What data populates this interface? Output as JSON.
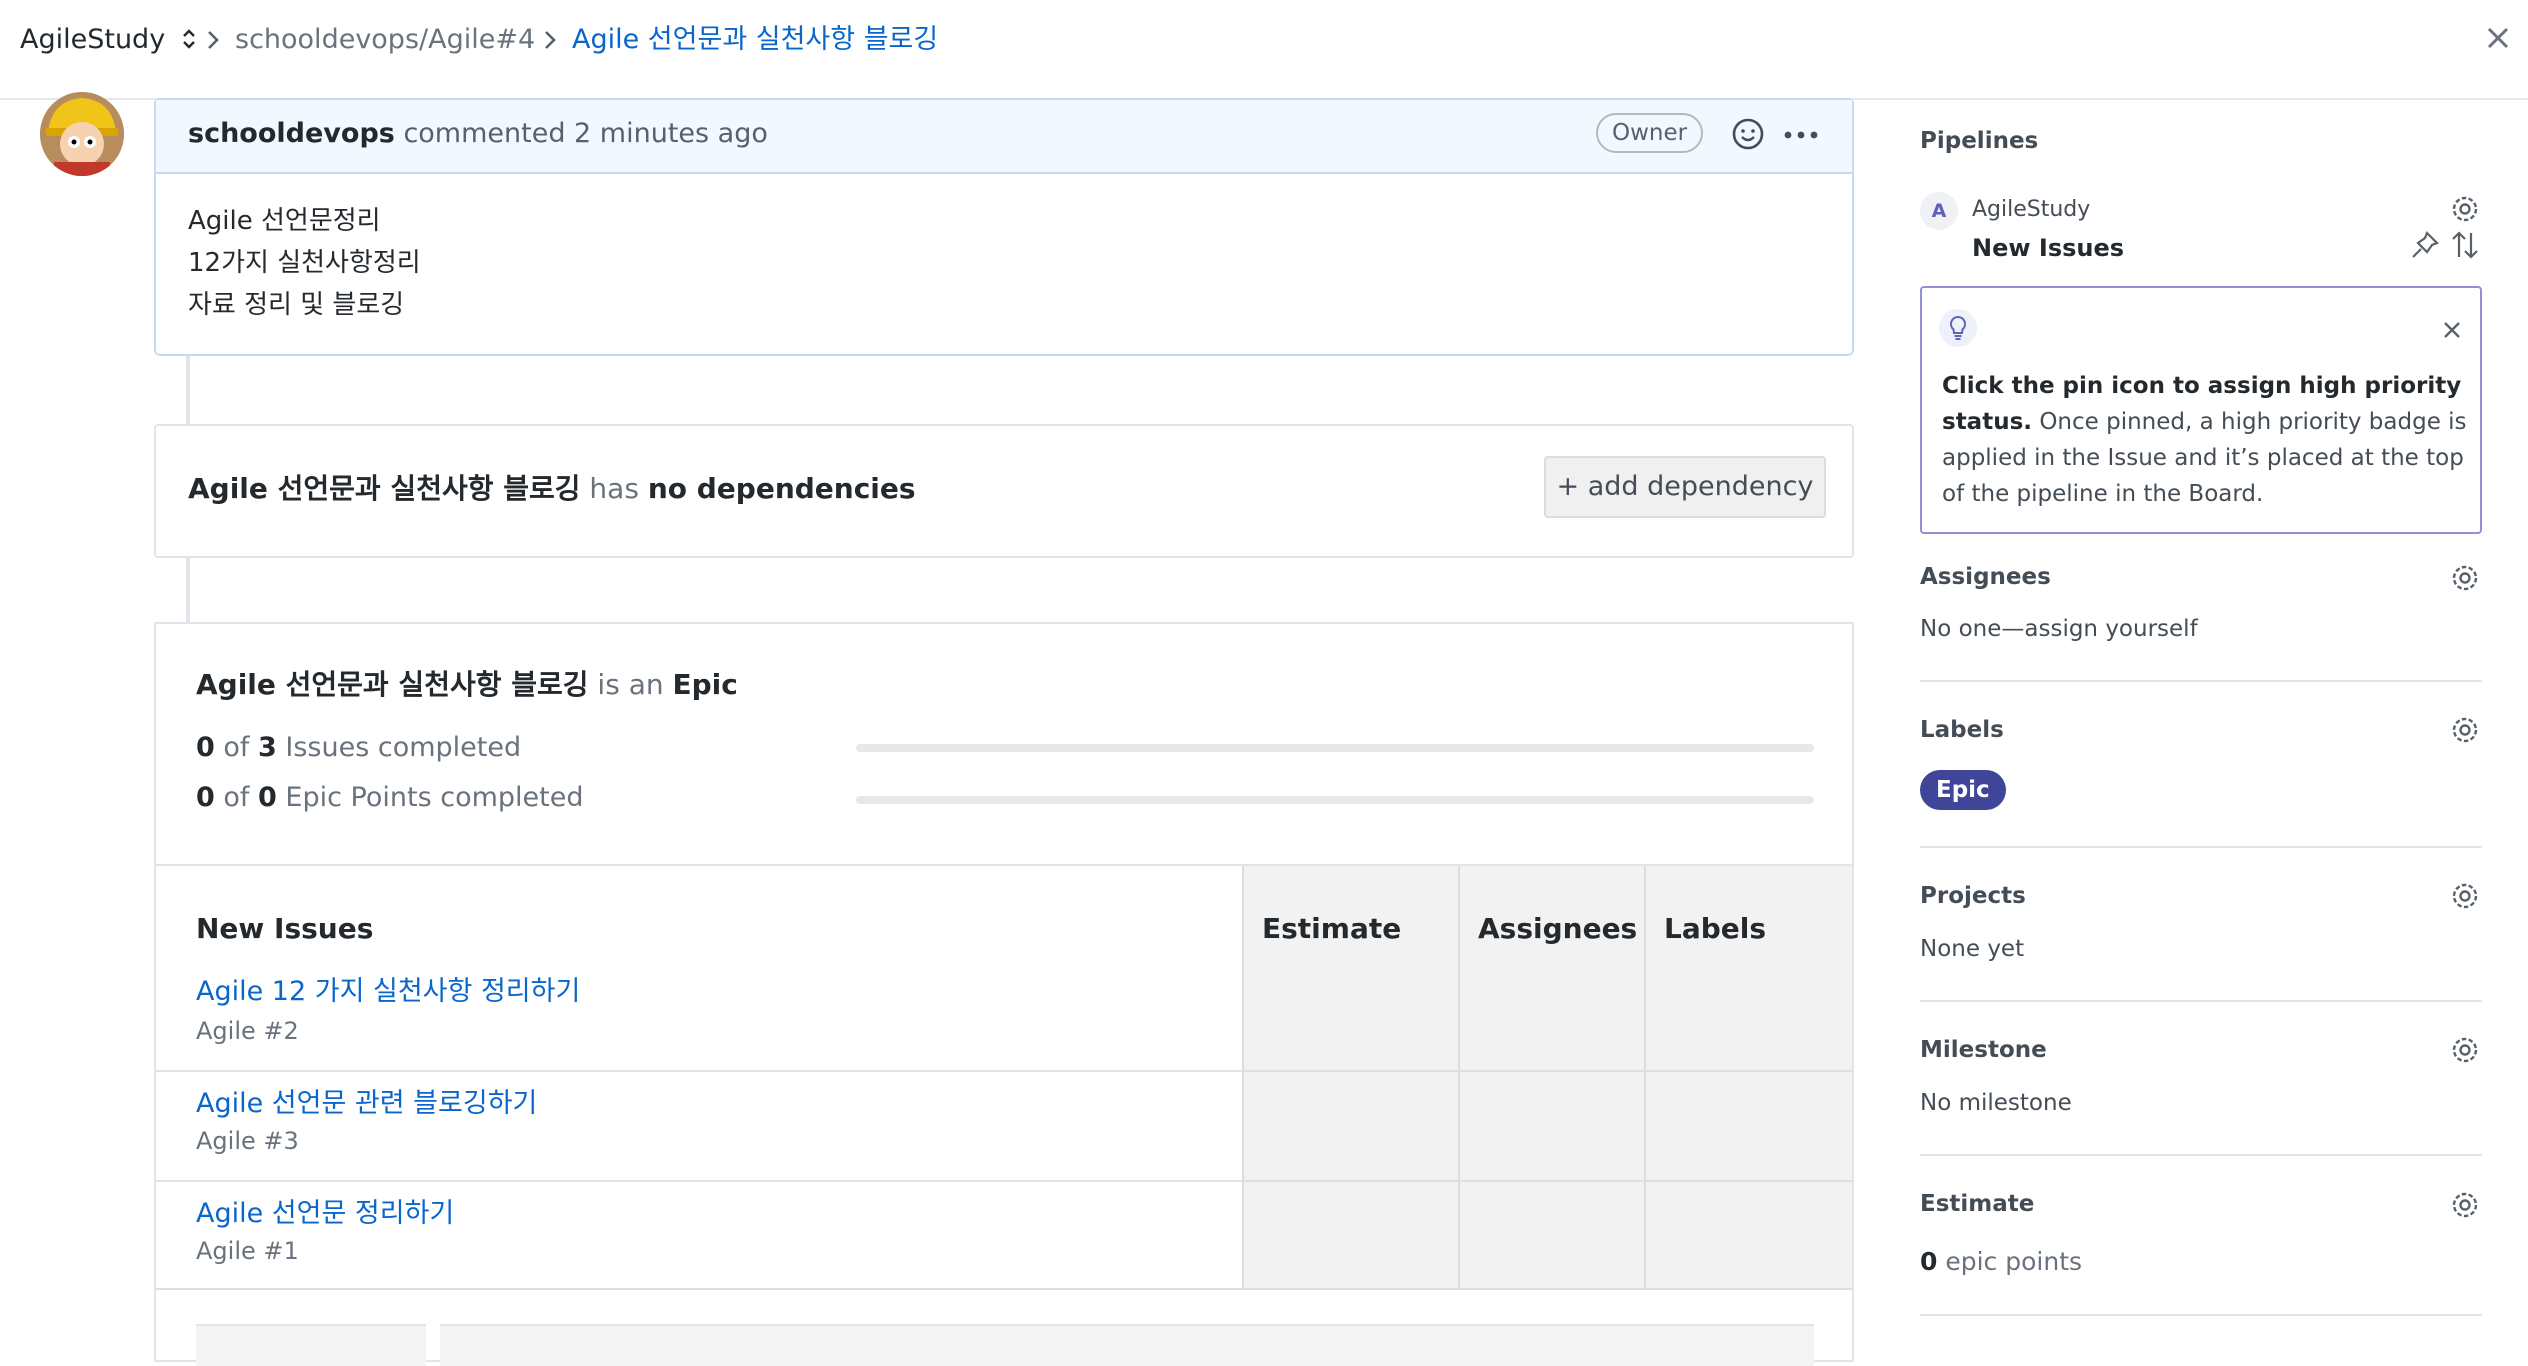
{
  "header": {
    "workspace": "AgileStudy",
    "repo_crumb": "schooldevops/Agile#4",
    "issue_title": "Agile 선언문과 실천사항 블로깅"
  },
  "comment": {
    "author": "schooldevops",
    "meta": "commented 2 minutes ago",
    "badge": "Owner",
    "lines": [
      "Agile 선언문정리",
      "12가지 실천사항정리",
      "자료 정리 및 블로깅"
    ]
  },
  "dependencies": {
    "issue": "Agile 선언문과 실천사항 블로깅",
    "connector": "has",
    "status": "no dependencies",
    "button": "+ add dependency"
  },
  "epic": {
    "issue": "Agile 선언문과 실천사항 블로깅",
    "connector": "is an",
    "kind": "Epic",
    "issues_done": "0",
    "issues_of": "of",
    "issues_total": "3",
    "issues_label": "Issues completed",
    "points_done": "0",
    "points_of": "of",
    "points_total": "0",
    "points_label": "Epic Points completed",
    "issues_progress": 0,
    "points_progress": 0,
    "columns": [
      "New Issues",
      "Estimate",
      "Assignees",
      "Labels"
    ],
    "rows": [
      {
        "title": "Agile 12 가지 실천사항 정리하기",
        "ref": "Agile #2"
      },
      {
        "title": "Agile 선언문 관련 블로깅하기",
        "ref": "Agile #3"
      },
      {
        "title": "Agile 선언문 정리하기",
        "ref": "Agile #1"
      }
    ]
  },
  "sidebar": {
    "pipelines": {
      "heading": "Pipelines",
      "avatar_letter": "A",
      "workspace": "AgileStudy",
      "pipeline": "New Issues"
    },
    "tip": {
      "bold": "Click the pin icon to assign high priority status.",
      "text": " Once pinned, a high priority badge is applied in the Issue and it’s placed at the top of the pipeline in the Board."
    },
    "assignees": {
      "heading": "Assignees",
      "value": "No one—assign yourself"
    },
    "labels": {
      "heading": "Labels",
      "value": "Epic",
      "color": "#3f4699"
    },
    "projects": {
      "heading": "Projects",
      "value": "None yet"
    },
    "milestone": {
      "heading": "Milestone",
      "value": "No milestone"
    },
    "estimate": {
      "heading": "Estimate",
      "value": "0",
      "unit": "epic points"
    }
  },
  "colors": {
    "link": "#0b66cc",
    "accent": "#5e60ba",
    "border": "#c8d9f2"
  },
  "icons": [
    "chevron-updown-icon",
    "chevron-right-icon",
    "close-icon",
    "emoji-icon",
    "more-icon",
    "gear-icon",
    "pin-icon",
    "sort-icon",
    "lightbulb-icon"
  ]
}
